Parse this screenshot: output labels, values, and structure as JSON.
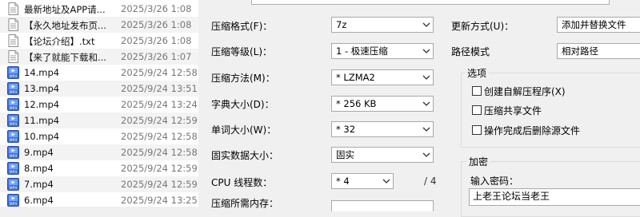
{
  "files": [
    {
      "name": "最新地址及APP请...",
      "date": "2025/3/26 1:08",
      "icon": "text-file-icon"
    },
    {
      "name": "【永久地址发布页...",
      "date": "2025/3/26 1:08",
      "icon": "text-file-icon"
    },
    {
      "name": "【论坛介绍】.txt",
      "date": "2025/3/26 1:08",
      "icon": "text-file-icon"
    },
    {
      "name": "【来了就能下载和...",
      "date": "2025/3/26 1:07",
      "icon": "text-file-icon"
    },
    {
      "name": "14.mp4",
      "date": "2025/9/24 12:58",
      "icon": "mp4-file-icon"
    },
    {
      "name": "13.mp4",
      "date": "2025/9/24 13:51",
      "icon": "mp4-file-icon"
    },
    {
      "name": "12.mp4",
      "date": "2025/9/24 13:24",
      "icon": "mp4-file-icon"
    },
    {
      "name": "11.mp4",
      "date": "2025/9/24 12:59",
      "icon": "mp4-file-icon"
    },
    {
      "name": "10.mp4",
      "date": "2025/9/24 12:58",
      "icon": "mp4-file-icon"
    },
    {
      "name": "9.mp4",
      "date": "2025/9/24 12:58",
      "icon": "mp4-file-icon"
    },
    {
      "name": "8.mp4",
      "date": "2025/9/24 12:59",
      "icon": "mp4-file-icon"
    },
    {
      "name": "7.mp4",
      "date": "2025/9/24 12:59",
      "icon": "mp4-file-icon"
    },
    {
      "name": "6.mp4",
      "date": "2025/9/24 13:25",
      "icon": "mp4-file-icon"
    }
  ],
  "dialog": {
    "format_label": "压缩格式(F)：",
    "format_value": "7z",
    "level_label": "压缩等级(L)：",
    "level_value": "1 - 极速压缩",
    "method_label": "压缩方法(M)：",
    "method_value": "* LZMA2",
    "dict_label": "字典大小(D)：",
    "dict_value": "* 256 KB",
    "word_label": "单词大小(W)：",
    "word_value": "* 32",
    "solid_label": "固实数据大小：",
    "solid_value": "固实",
    "threads_label": "CPU 线程数：",
    "threads_value": "* 4",
    "threads_total": "/ 4",
    "memory_label": "压缩所需内存：",
    "update_label": "更新方式(U)：",
    "update_value": "添加并替换文件",
    "path_label": "路径模式",
    "path_value": "相对路径",
    "options_title": "选项",
    "opt_sfx": "创建自解压程序(X)",
    "opt_shared": "压缩共享文件",
    "opt_delete": "操作完成后删除源文件",
    "encrypt_title": "加密",
    "password_label": "输入密码：",
    "password_value": "上老王论坛当老王"
  }
}
